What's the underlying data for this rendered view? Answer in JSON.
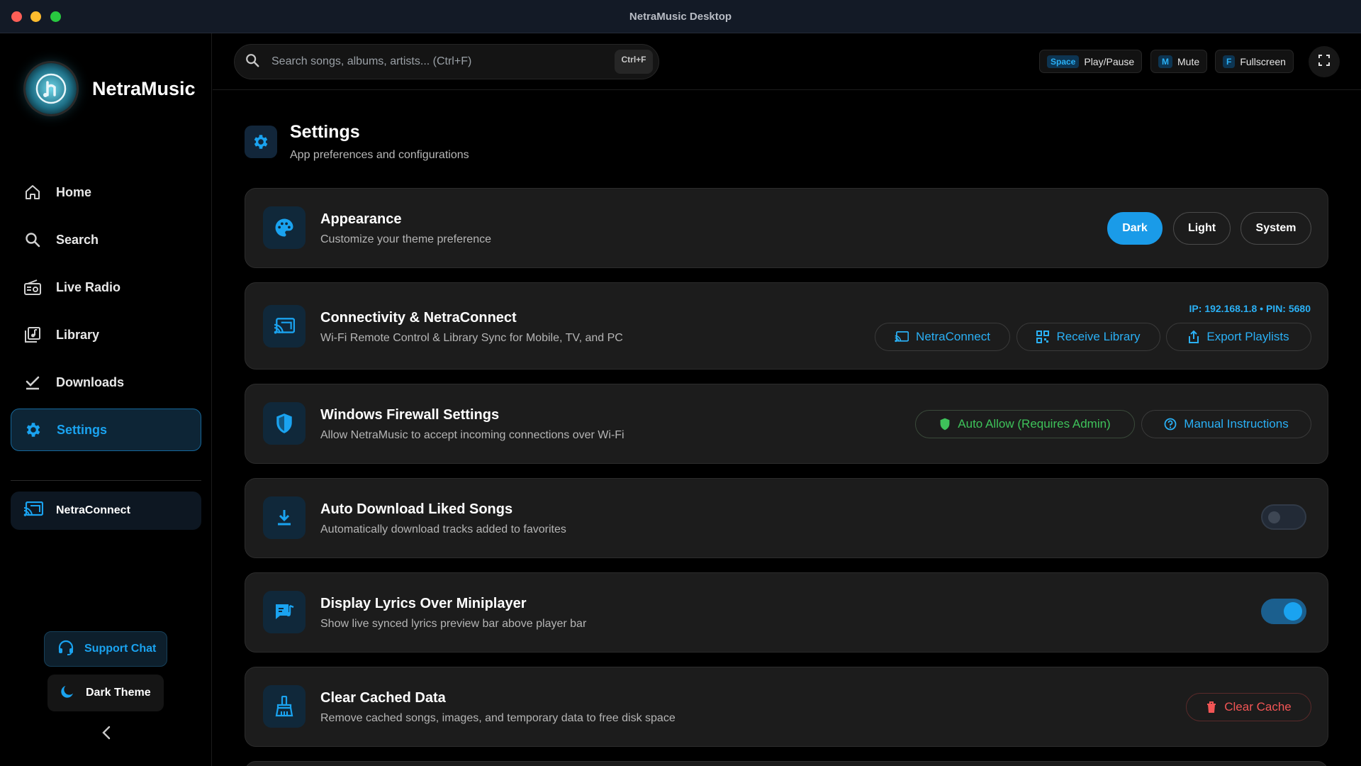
{
  "window": {
    "title": "NetraMusic Desktop"
  },
  "sidebar": {
    "brand": "NetraMusic",
    "items": [
      {
        "label": "Home",
        "icon": "home-icon"
      },
      {
        "label": "Search",
        "icon": "search-icon"
      },
      {
        "label": "Live Radio",
        "icon": "radio-icon"
      },
      {
        "label": "Library",
        "icon": "library-icon"
      },
      {
        "label": "Downloads",
        "icon": "download-check-icon"
      },
      {
        "label": "Settings",
        "icon": "gear-icon",
        "active": true
      }
    ],
    "netraconnect_label": "NetraConnect",
    "support_label": "Support Chat",
    "theme_label": "Dark Theme"
  },
  "topbar": {
    "search_placeholder": "Search songs, albums, artists... (Ctrl+F)",
    "search_shortcut": "Ctrl+F",
    "shortcuts": [
      {
        "key": "Space",
        "label": "Play/Pause"
      },
      {
        "key": "M",
        "label": "Mute"
      },
      {
        "key": "F",
        "label": "Fullscreen"
      }
    ]
  },
  "page": {
    "title": "Settings",
    "subtitle": "App preferences and configurations"
  },
  "cards": {
    "appearance": {
      "title": "Appearance",
      "subtitle": "Customize your theme preference",
      "options": [
        "Dark",
        "Light",
        "System"
      ],
      "selected": "Dark"
    },
    "connectivity": {
      "title": "Connectivity & NetraConnect",
      "subtitle": "Wi-Fi Remote Control & Library Sync for Mobile, TV, and PC",
      "ip_line": "IP: 192.168.1.8 • PIN: 5680",
      "buttons": [
        "NetraConnect",
        "Receive Library",
        "Export Playlists"
      ]
    },
    "firewall": {
      "title": "Windows Firewall Settings",
      "subtitle": "Allow NetraMusic to accept incoming connections over Wi-Fi",
      "auto_allow": "Auto Allow (Requires Admin)",
      "manual": "Manual Instructions"
    },
    "auto_download": {
      "title": "Auto Download Liked Songs",
      "subtitle": "Automatically download tracks added to favorites",
      "enabled": false
    },
    "lyrics": {
      "title": "Display Lyrics Over Miniplayer",
      "subtitle": "Show live synced lyrics preview bar above player bar",
      "enabled": true
    },
    "cache": {
      "title": "Clear Cached Data",
      "subtitle": "Remove cached songs, images, and temporary data to free disk space",
      "button": "Clear Cache"
    }
  },
  "colors": {
    "accent": "#1a9be8",
    "accent_text": "#2ab0f5",
    "success": "#3ec25a",
    "danger": "#f25555",
    "card_bg": "#1c1c1c"
  }
}
